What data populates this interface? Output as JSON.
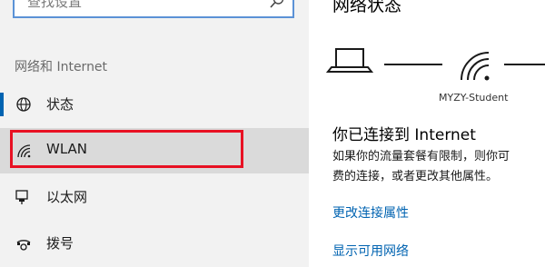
{
  "search": {
    "placeholder": "查找设置"
  },
  "sidebar": {
    "section_title": "网络和 Internet",
    "items": [
      {
        "label": "状态",
        "icon": "globe-icon",
        "selected": false,
        "active": true
      },
      {
        "label": "WLAN",
        "icon": "wifi-icon",
        "selected": true,
        "active": false
      },
      {
        "label": "以太网",
        "icon": "ethernet-icon",
        "selected": false,
        "active": false
      },
      {
        "label": "拨号",
        "icon": "dialup-icon",
        "selected": false,
        "active": false
      }
    ]
  },
  "main": {
    "title": "网络状态",
    "network_name": "MYZY-Student",
    "status_heading": "你已连接到 Internet",
    "status_desc_line1": "如果你的流量套餐有限制，则你可",
    "status_desc_line2": "费的连接，或者更改其他属性。",
    "links": [
      {
        "label": "更改连接属性"
      },
      {
        "label": "显示可用网络"
      }
    ]
  },
  "colors": {
    "accent": "#0063b1",
    "highlight_border": "#e81123",
    "sidebar_bg": "#f2f2f2",
    "selected_bg": "#dadada"
  }
}
